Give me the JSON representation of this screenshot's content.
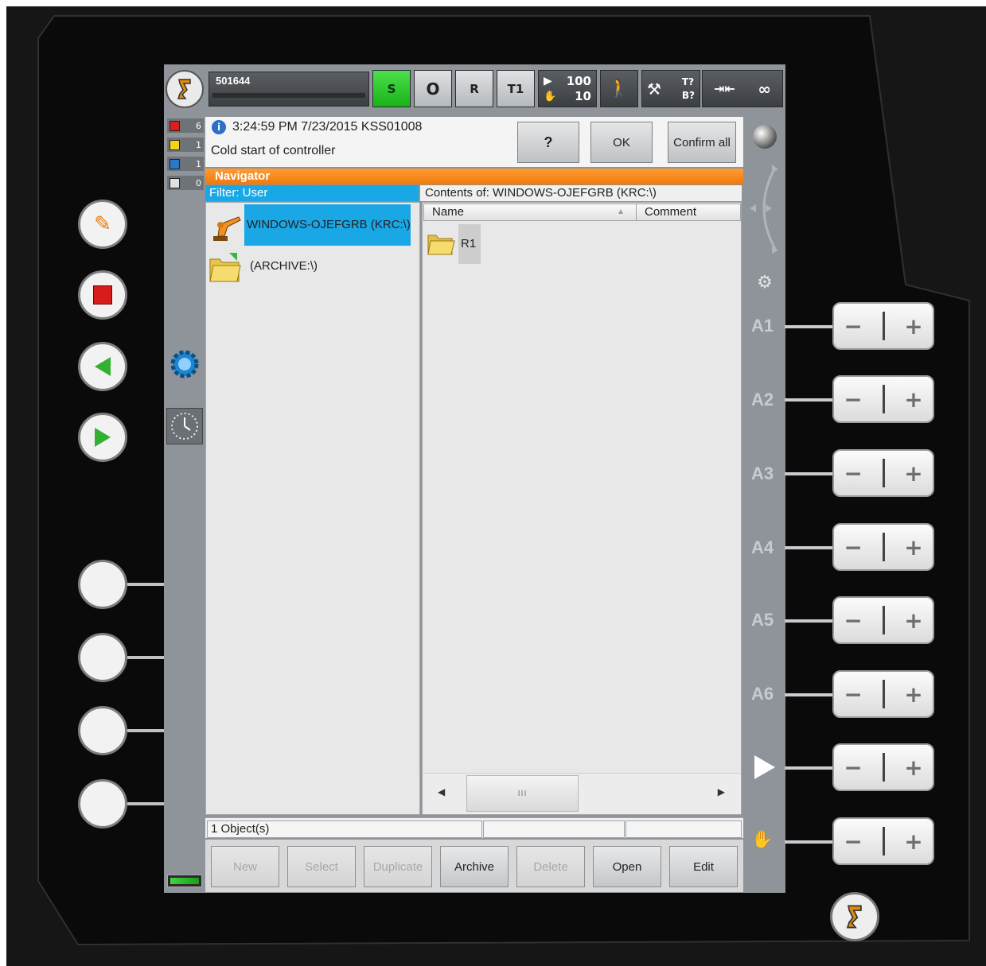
{
  "topbar": {
    "robot_name": "501644",
    "s_label": "S",
    "o_label": "O",
    "r_label": "R",
    "mode_label": "T1",
    "override_prog": "100",
    "override_jog": "10",
    "tb_label_top": "T?",
    "tb_label_bottom": "B?",
    "infinity_label": "∞"
  },
  "message": {
    "timestamp_line": "3:24:59 PM 7/23/2015 KSS01008",
    "text": "Cold start of controller",
    "help_label": "?",
    "ok_label": "OK",
    "confirm_all_label": "Confirm all"
  },
  "message_counts": {
    "error": "6",
    "warning": "1",
    "info": "1",
    "other": "0"
  },
  "navigator": {
    "title": "Navigator",
    "filter_label": "Filter: User",
    "contents_label": "Contents of: WINDOWS-OJEFGRB (KRC:\\)",
    "tree": [
      {
        "label": "WINDOWS-OJEFGRB (KRC:\\)",
        "selected": true
      },
      {
        "label": "(ARCHIVE:\\)",
        "selected": false
      }
    ],
    "columns": {
      "name": "Name",
      "comment": "Comment"
    },
    "items": [
      {
        "name": "R1",
        "comment": ""
      }
    ],
    "scroll_grip": "III",
    "status_objects": "1 Object(s)"
  },
  "softkeys": {
    "new": "New",
    "select": "Select",
    "duplicate": "Duplicate",
    "archive": "Archive",
    "delete": "Delete",
    "open": "Open",
    "edit": "Edit"
  },
  "axes": {
    "a1": "A1",
    "a2": "A2",
    "a3": "A3",
    "a4": "A4",
    "a5": "A5",
    "a6": "A6"
  },
  "colors": {
    "nav_orange": "#f38a1c",
    "selection_blue": "#19a7e6",
    "s_green": "#28c828"
  }
}
